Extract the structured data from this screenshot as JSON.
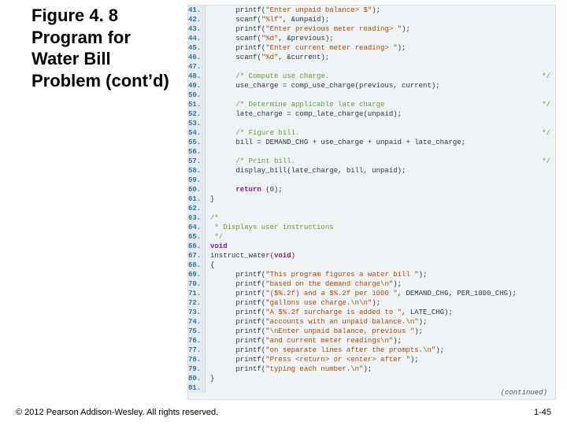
{
  "title": "Figure 4. 8 Program for Water Bill Problem (cont’d)",
  "footer": "© 2012 Pearson Addison-Wesley. All rights reserved.",
  "pagenum": "1-45",
  "continued": "(continued)",
  "code": [
    {
      "n": 41,
      "ind": 2,
      "seg": [
        {
          "c": "id",
          "t": "printf("
        },
        {
          "c": "str",
          "t": "\"Enter unpaid balance> $\""
        },
        {
          "c": "id",
          "t": ");"
        }
      ]
    },
    {
      "n": 42,
      "ind": 2,
      "seg": [
        {
          "c": "id",
          "t": "scanf("
        },
        {
          "c": "str",
          "t": "\"%lf\""
        },
        {
          "c": "id",
          "t": ", &unpaid);"
        }
      ]
    },
    {
      "n": 43,
      "ind": 2,
      "seg": [
        {
          "c": "id",
          "t": "printf("
        },
        {
          "c": "str",
          "t": "\"Enter previous meter reading> \""
        },
        {
          "c": "id",
          "t": ");"
        }
      ]
    },
    {
      "n": 44,
      "ind": 2,
      "seg": [
        {
          "c": "id",
          "t": "scanf("
        },
        {
          "c": "str",
          "t": "\"%d\""
        },
        {
          "c": "id",
          "t": ", &previous);"
        }
      ]
    },
    {
      "n": 45,
      "ind": 2,
      "seg": [
        {
          "c": "id",
          "t": "printf("
        },
        {
          "c": "str",
          "t": "\"Enter current meter reading> \""
        },
        {
          "c": "id",
          "t": ");"
        }
      ]
    },
    {
      "n": 46,
      "ind": 2,
      "seg": [
        {
          "c": "id",
          "t": "scanf("
        },
        {
          "c": "str",
          "t": "\"%d\""
        },
        {
          "c": "id",
          "t": ", &current);"
        }
      ]
    },
    {
      "n": 47,
      "ind": 0,
      "seg": []
    },
    {
      "n": 48,
      "ind": 2,
      "seg": [
        {
          "c": "cm",
          "t": "/* Compute use charge."
        }
      ],
      "star": true
    },
    {
      "n": 49,
      "ind": 2,
      "seg": [
        {
          "c": "id",
          "t": "use_charge = comp_use_charge(previous, current);"
        }
      ]
    },
    {
      "n": 50,
      "ind": 0,
      "seg": []
    },
    {
      "n": 51,
      "ind": 2,
      "seg": [
        {
          "c": "cm",
          "t": "/* Determine applicable late charge"
        }
      ],
      "star": true
    },
    {
      "n": 52,
      "ind": 2,
      "seg": [
        {
          "c": "id",
          "t": "late_charge = comp_late_charge(unpaid);"
        }
      ]
    },
    {
      "n": 53,
      "ind": 0,
      "seg": []
    },
    {
      "n": 54,
      "ind": 2,
      "seg": [
        {
          "c": "cm",
          "t": "/* Figure bill."
        }
      ],
      "star": true
    },
    {
      "n": 55,
      "ind": 2,
      "seg": [
        {
          "c": "id",
          "t": "bill = DEMAND_CHG + use_charge + unpaid + late_charge;"
        }
      ]
    },
    {
      "n": 56,
      "ind": 0,
      "seg": []
    },
    {
      "n": 57,
      "ind": 2,
      "seg": [
        {
          "c": "cm",
          "t": "/* Print bill."
        }
      ],
      "star": true
    },
    {
      "n": 58,
      "ind": 2,
      "seg": [
        {
          "c": "id",
          "t": "display_bill(late_charge, bill, unpaid);"
        }
      ]
    },
    {
      "n": 59,
      "ind": 0,
      "seg": []
    },
    {
      "n": 60,
      "ind": 2,
      "seg": [
        {
          "c": "kw",
          "t": "return"
        },
        {
          "c": "id",
          "t": " (0);"
        }
      ]
    },
    {
      "n": 61,
      "ind": 0,
      "seg": [
        {
          "c": "id",
          "t": "}"
        }
      ]
    },
    {
      "n": 62,
      "ind": 0,
      "seg": []
    },
    {
      "n": 63,
      "ind": 0,
      "seg": [
        {
          "c": "cm",
          "t": "/*"
        }
      ]
    },
    {
      "n": 64,
      "ind": 0,
      "seg": [
        {
          "c": "cm",
          "t": " * Displays user instructions"
        }
      ]
    },
    {
      "n": 65,
      "ind": 0,
      "seg": [
        {
          "c": "cm",
          "t": " */"
        }
      ]
    },
    {
      "n": 66,
      "ind": 0,
      "seg": [
        {
          "c": "kw",
          "t": "void"
        }
      ]
    },
    {
      "n": 67,
      "ind": 0,
      "seg": [
        {
          "c": "id",
          "t": "instruct_water("
        },
        {
          "c": "kw",
          "t": "void"
        },
        {
          "c": "id",
          "t": ")"
        }
      ]
    },
    {
      "n": 68,
      "ind": 0,
      "seg": [
        {
          "c": "id",
          "t": "{"
        }
      ]
    },
    {
      "n": 69,
      "ind": 2,
      "seg": [
        {
          "c": "id",
          "t": "printf("
        },
        {
          "c": "str",
          "t": "\"This program figures a water bill \""
        },
        {
          "c": "id",
          "t": ");"
        }
      ]
    },
    {
      "n": 70,
      "ind": 2,
      "seg": [
        {
          "c": "id",
          "t": "printf("
        },
        {
          "c": "str",
          "t": "\"based on the demand charge\\n\""
        },
        {
          "c": "id",
          "t": ");"
        }
      ]
    },
    {
      "n": 71,
      "ind": 2,
      "seg": [
        {
          "c": "id",
          "t": "printf("
        },
        {
          "c": "str",
          "t": "\"($%.2f) and a $%.2f per 1000 \""
        },
        {
          "c": "id",
          "t": ", DEMAND_CHG, PER_1000_CHG);"
        }
      ]
    },
    {
      "n": 72,
      "ind": 2,
      "seg": [
        {
          "c": "id",
          "t": "printf("
        },
        {
          "c": "str",
          "t": "\"gallons use charge.\\n\\n\""
        },
        {
          "c": "id",
          "t": ");"
        }
      ]
    },
    {
      "n": 73,
      "ind": 2,
      "seg": [
        {
          "c": "id",
          "t": "printf("
        },
        {
          "c": "str",
          "t": "\"A $%.2f surcharge is added to \""
        },
        {
          "c": "id",
          "t": ", LATE_CHG);"
        }
      ]
    },
    {
      "n": 74,
      "ind": 2,
      "seg": [
        {
          "c": "id",
          "t": "printf("
        },
        {
          "c": "str",
          "t": "\"accounts with an unpaid balance.\\n\""
        },
        {
          "c": "id",
          "t": ");"
        }
      ]
    },
    {
      "n": 75,
      "ind": 2,
      "seg": [
        {
          "c": "id",
          "t": "printf("
        },
        {
          "c": "str",
          "t": "\"\\nEnter unpaid balance, previous \""
        },
        {
          "c": "id",
          "t": ");"
        }
      ]
    },
    {
      "n": 76,
      "ind": 2,
      "seg": [
        {
          "c": "id",
          "t": "printf("
        },
        {
          "c": "str",
          "t": "\"and current meter readings\\n\""
        },
        {
          "c": "id",
          "t": ");"
        }
      ]
    },
    {
      "n": 77,
      "ind": 2,
      "seg": [
        {
          "c": "id",
          "t": "printf("
        },
        {
          "c": "str",
          "t": "\"on separate lines after the prompts.\\n\""
        },
        {
          "c": "id",
          "t": ");"
        }
      ]
    },
    {
      "n": 78,
      "ind": 2,
      "seg": [
        {
          "c": "id",
          "t": "printf("
        },
        {
          "c": "str",
          "t": "\"Press <return> or <enter> after \""
        },
        {
          "c": "id",
          "t": ");"
        }
      ]
    },
    {
      "n": 79,
      "ind": 2,
      "seg": [
        {
          "c": "id",
          "t": "printf("
        },
        {
          "c": "str",
          "t": "\"typing each number.\\n\""
        },
        {
          "c": "id",
          "t": ");"
        }
      ]
    },
    {
      "n": 80,
      "ind": 0,
      "seg": [
        {
          "c": "id",
          "t": "}"
        }
      ]
    },
    {
      "n": 81,
      "ind": 0,
      "seg": []
    }
  ]
}
